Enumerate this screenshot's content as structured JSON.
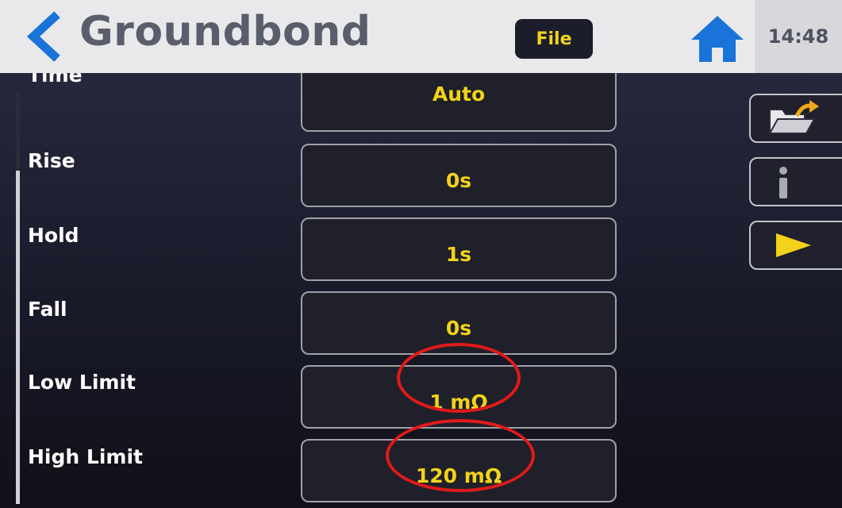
{
  "header": {
    "title": "Groundbond",
    "file_label": "File",
    "time": "14:48"
  },
  "settings": {
    "time_label": "Time",
    "time_value": "Auto",
    "rise_label": "Rise",
    "rise_value": "0s",
    "hold_label": "Hold",
    "hold_value": "1s",
    "fall_label": "Fall",
    "fall_value": "0s",
    "low_limit_label": "Low Limit",
    "low_limit_value": "1 mΩ",
    "high_limit_label": "High Limit",
    "high_limit_value": "120 mΩ"
  },
  "side_buttons": [
    "folder-open-icon",
    "info-icon",
    "play-icon"
  ],
  "colors": {
    "accent_yellow": "#f2d31a",
    "home_blue": "#1a73d9",
    "back_blue": "#1a73d9",
    "annotation_red": "#e01a1a"
  }
}
